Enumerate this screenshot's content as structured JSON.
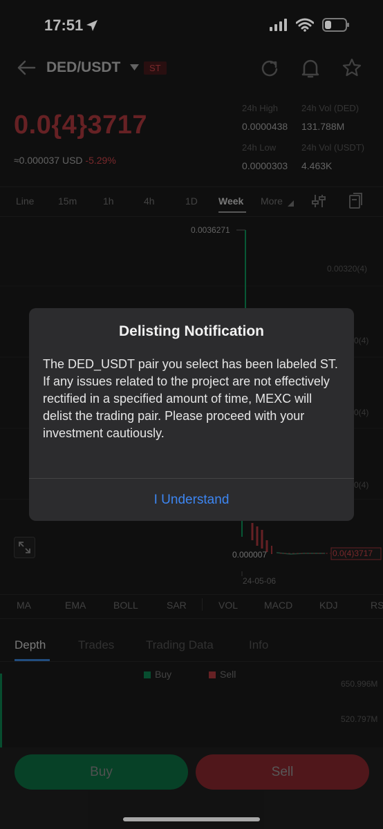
{
  "status": {
    "time": "17:51"
  },
  "header": {
    "pair": "DED/USDT",
    "badge": "ST"
  },
  "ticker": {
    "price": "0.0{4}3717",
    "usd": "≈0.000037 USD",
    "change": "-5.29%",
    "high_label": "24h High",
    "high_value": "0.0000438",
    "vol_ded_label": "24h Vol (DED)",
    "vol_ded_value": "131.788M",
    "low_label": "24h Low",
    "low_value": "0.0000303",
    "vol_usdt_label": "24h Vol  (USDT)",
    "vol_usdt_value": "4.463K"
  },
  "timeframes": [
    "Line",
    "15m",
    "1h",
    "4h",
    "1D",
    "Week",
    "More"
  ],
  "chart": {
    "max_label": "0.0036271",
    "min_label": "0.000007",
    "y_labels": [
      "0.00320(4)",
      "0(4)",
      "0(4)",
      "0(4)"
    ],
    "current_price_tag": "0.0(4)3717",
    "date_label": "24-05-06"
  },
  "indicators": [
    "MA",
    "EMA",
    "BOLL",
    "SAR",
    "VOL",
    "MACD",
    "KDJ",
    "RS"
  ],
  "sub_tabs": [
    "Depth",
    "Trades",
    "Trading Data",
    "Info"
  ],
  "depth": {
    "buy_label": "Buy",
    "sell_label": "Sell",
    "axis_1": "650.996M",
    "axis_2": "520.797M"
  },
  "actions": {
    "buy": "Buy",
    "sell": "Sell"
  },
  "dialog": {
    "title": "Delisting Notification",
    "body": "The DED_USDT pair you select has been labeled ST. If any issues related to the project are not effectively rectified in a specified amount of time, MEXC will delist the trading pair. Please proceed with your investment cautiously.",
    "button": "I Understand"
  },
  "colors": {
    "accent_blue": "#3d86f2",
    "buy_green": "#0b5a36",
    "sell_red": "#6f2126"
  }
}
